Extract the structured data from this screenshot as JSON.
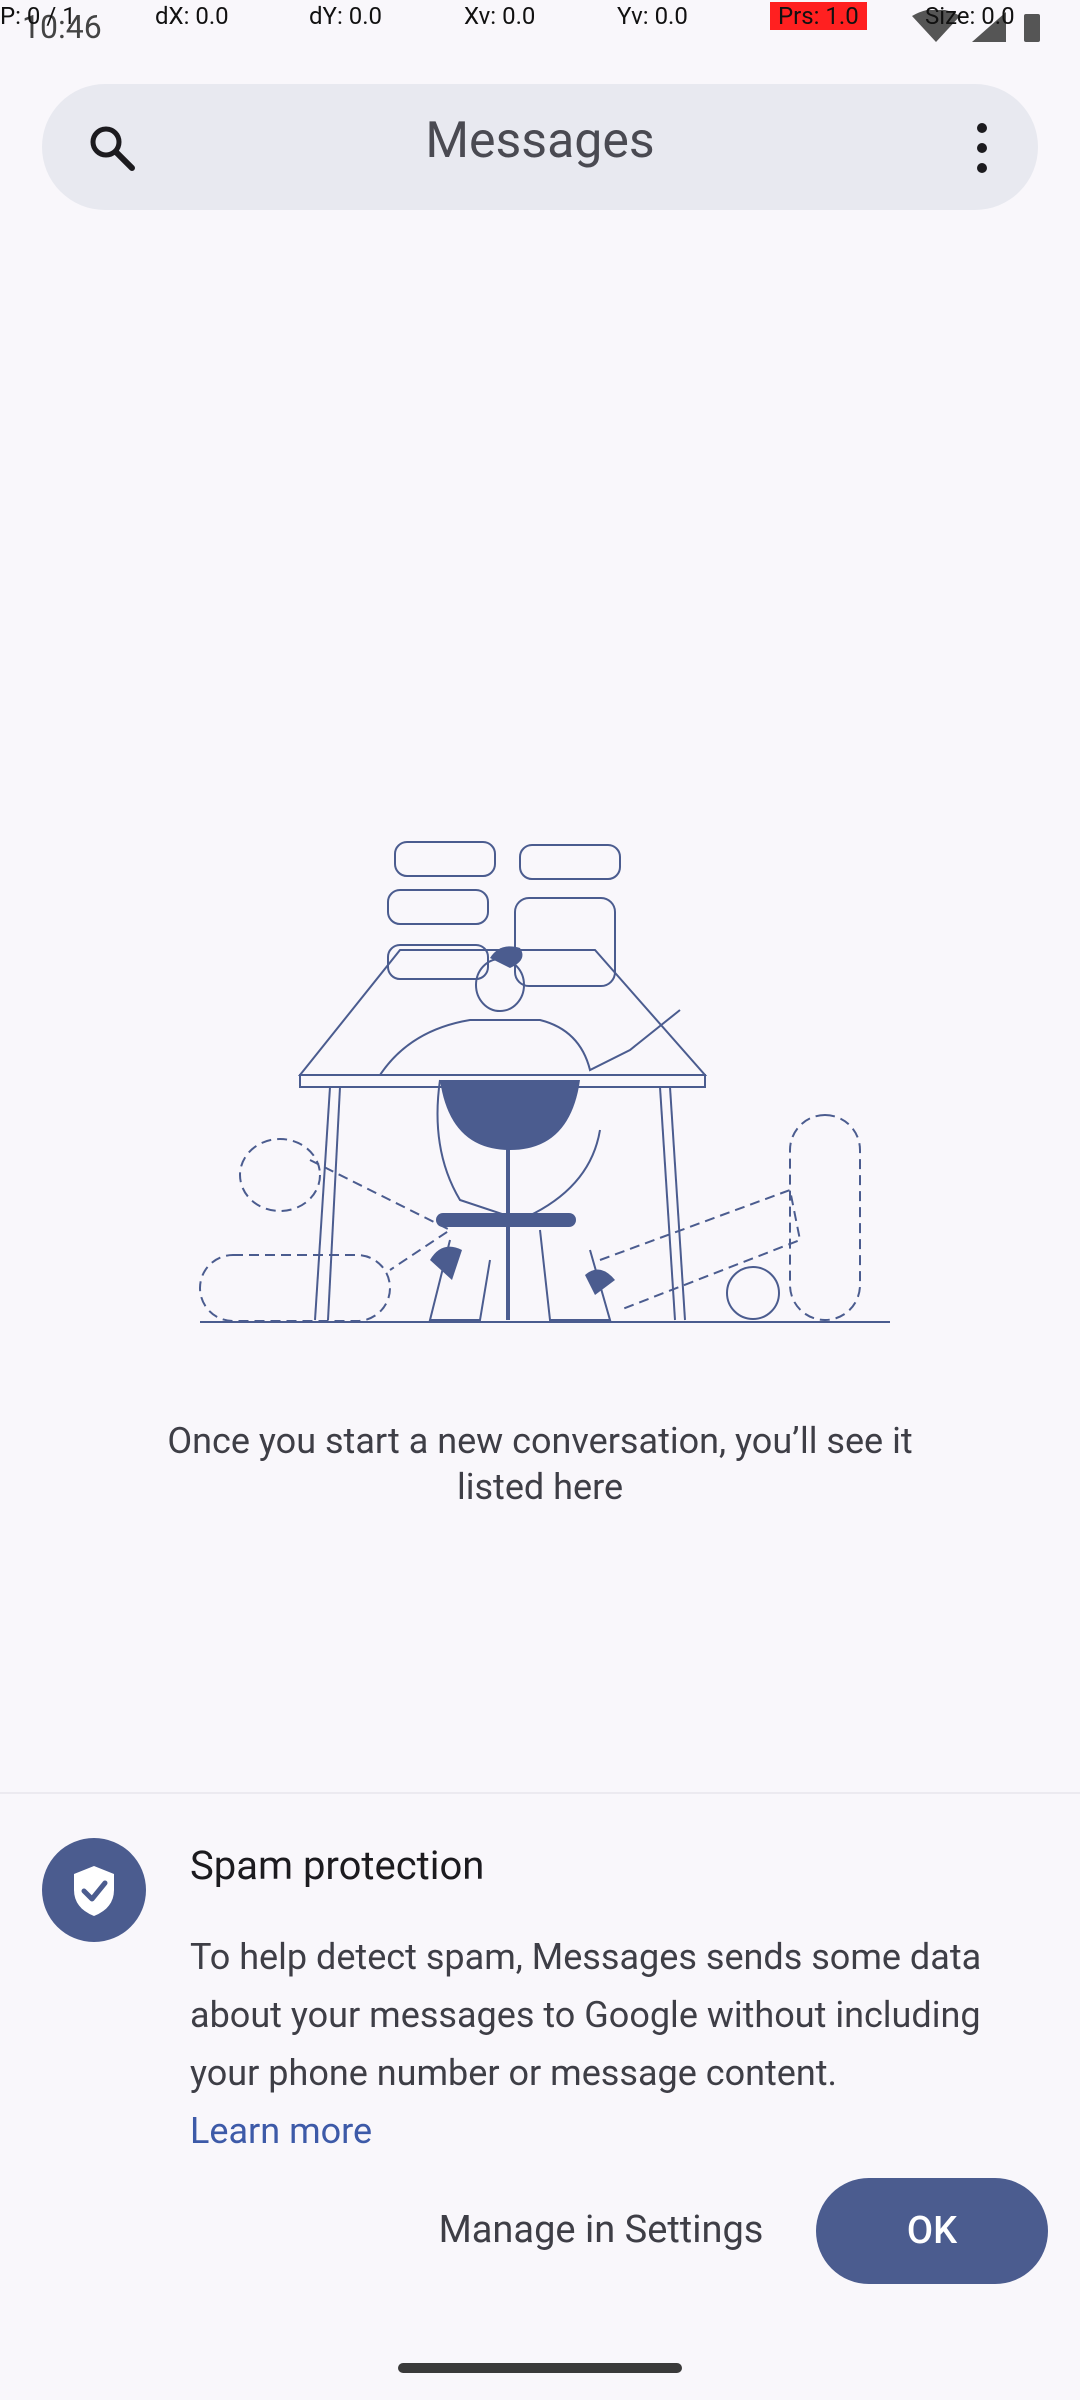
{
  "status_bar": {
    "time": "10:46"
  },
  "debug_overlay": {
    "p": "P: 0 / 1",
    "dx": "dX: 0.0",
    "dy": "dY: 0.0",
    "xv": "Xv: 0.0",
    "yv": "Yv: 0.0",
    "prs": "Prs: 1.0",
    "size": "Size: 0.0"
  },
  "search_bar": {
    "title": "Messages",
    "search_icon": "search-icon",
    "more_icon": "more-vert-icon"
  },
  "empty_state": {
    "message": "Once you start a new conversation, you’ll see it listed here"
  },
  "spam_protection": {
    "icon": "shield-check-icon",
    "title": "Spam protection",
    "body": "To help detect spam, Messages sends some data about your messages to Google without including your phone number or message content.",
    "learn_more": "Learn more",
    "manage_button": "Manage in Settings",
    "ok_button": "OK"
  },
  "colors": {
    "accent": "#4b5c8f",
    "background": "#f9f7fb",
    "search_bar_bg": "#e8e9f0",
    "link": "#3d5aa8",
    "debug_highlight": "#ff2020"
  }
}
